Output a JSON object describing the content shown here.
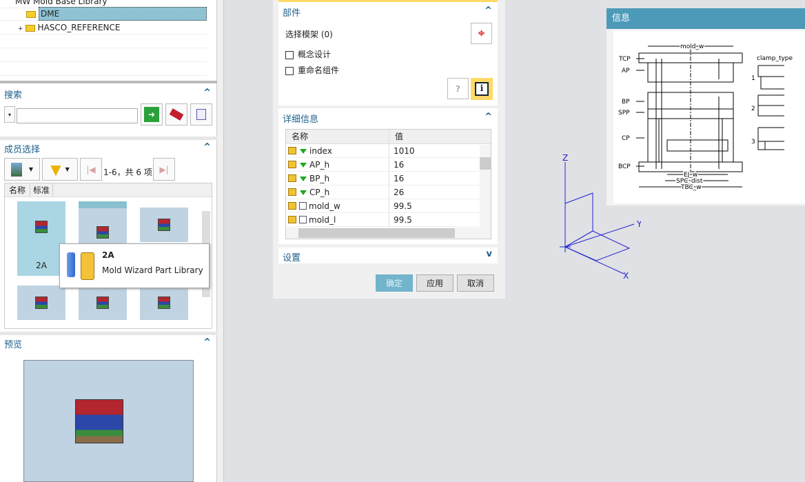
{
  "tree": {
    "items": [
      {
        "label": "MW Mold Base Library"
      },
      {
        "label": "DME",
        "selected": true
      },
      {
        "label": "HASCO_REFERENCE"
      }
    ]
  },
  "search": {
    "title": "搜索",
    "value": "",
    "placeholder": ""
  },
  "members": {
    "title": "成员选择",
    "paging": "1-6，共 6 项",
    "columns": [
      "名称",
      "标准"
    ],
    "items": [
      {
        "label": "2A"
      },
      {
        "label": ""
      },
      {
        "label": ""
      },
      {
        "label": ""
      },
      {
        "label": ""
      },
      {
        "label": ""
      }
    ]
  },
  "tooltip": {
    "title": "2A",
    "subtitle": "Mold Wizard Part Library"
  },
  "preview": {
    "title": "预览"
  },
  "dialog": {
    "parts": {
      "title": "部件",
      "select_label": "选择模架 (0)",
      "checkboxes": [
        {
          "label": "概念设计",
          "checked": false
        },
        {
          "label": "重命名组件",
          "checked": false
        }
      ]
    },
    "details": {
      "title": "详细信息",
      "columns": [
        "名称",
        "值"
      ],
      "rows": [
        {
          "name": "index",
          "value": "1010",
          "icon": "triangle"
        },
        {
          "name": "AP_h",
          "value": "16",
          "icon": "triangle"
        },
        {
          "name": "BP_h",
          "value": "16",
          "icon": "triangle"
        },
        {
          "name": "CP_h",
          "value": "26",
          "icon": "triangle"
        },
        {
          "name": "mold_w",
          "value": "99.5",
          "icon": "expression"
        },
        {
          "name": "mold_l",
          "value": "99.5",
          "icon": "expression"
        }
      ]
    },
    "settings": {
      "title": "设置"
    },
    "buttons": {
      "ok": "确定",
      "apply": "应用",
      "cancel": "取消"
    }
  },
  "info": {
    "title": "信息",
    "labels": {
      "tcp": "TCP",
      "ap": "AP",
      "bp": "BP",
      "spp": "SPP",
      "cp": "CP",
      "bcp": "BCP",
      "mold_w": "mold_w",
      "ej_w": "EJ_w",
      "spc_dist": "SPC_dist",
      "tbc_w": "TBC_w",
      "clamp_type": "clamp_type",
      "c1": "1",
      "c2": "2",
      "c3": "3"
    }
  },
  "axes": {
    "x": "X",
    "y": "Y",
    "z": "Z"
  },
  "colors": {
    "accent": "#4d9ab8",
    "selected": "#8fc3d3",
    "highlight": "#ffd966",
    "axis": "#2020d0"
  }
}
